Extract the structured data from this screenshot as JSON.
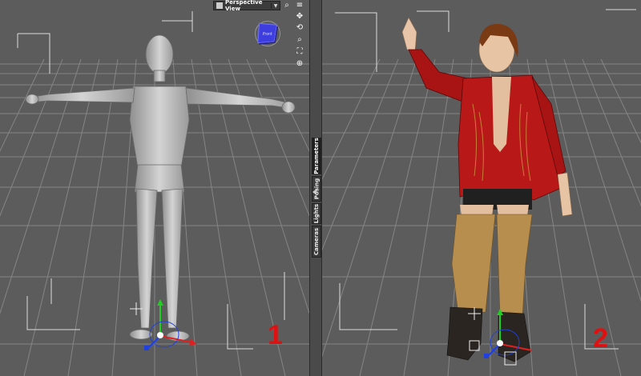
{
  "viewport_left": {
    "view_dropdown": {
      "label": "Perspective View",
      "icon": "camera-icon"
    },
    "marker": "1",
    "figure": "base-figure"
  },
  "viewport_right": {
    "marker": "2",
    "figure": "clothed-figure"
  },
  "side_tabs": [
    "Parameters",
    "Posing",
    "Lights",
    "Cameras"
  ],
  "active_tab": "Parameters",
  "nav_tools": [
    "search-icon",
    "pan-icon",
    "rotate-icon",
    "zoom-icon",
    "frame-icon"
  ],
  "colors": {
    "viewport_bg": "#5c5c5c",
    "grid_line": "#858585",
    "marker": "#e01010",
    "nav_cube": "#3d3de0",
    "axis_x": "#e02020",
    "axis_y": "#20d020",
    "axis_z": "#2040e0"
  }
}
